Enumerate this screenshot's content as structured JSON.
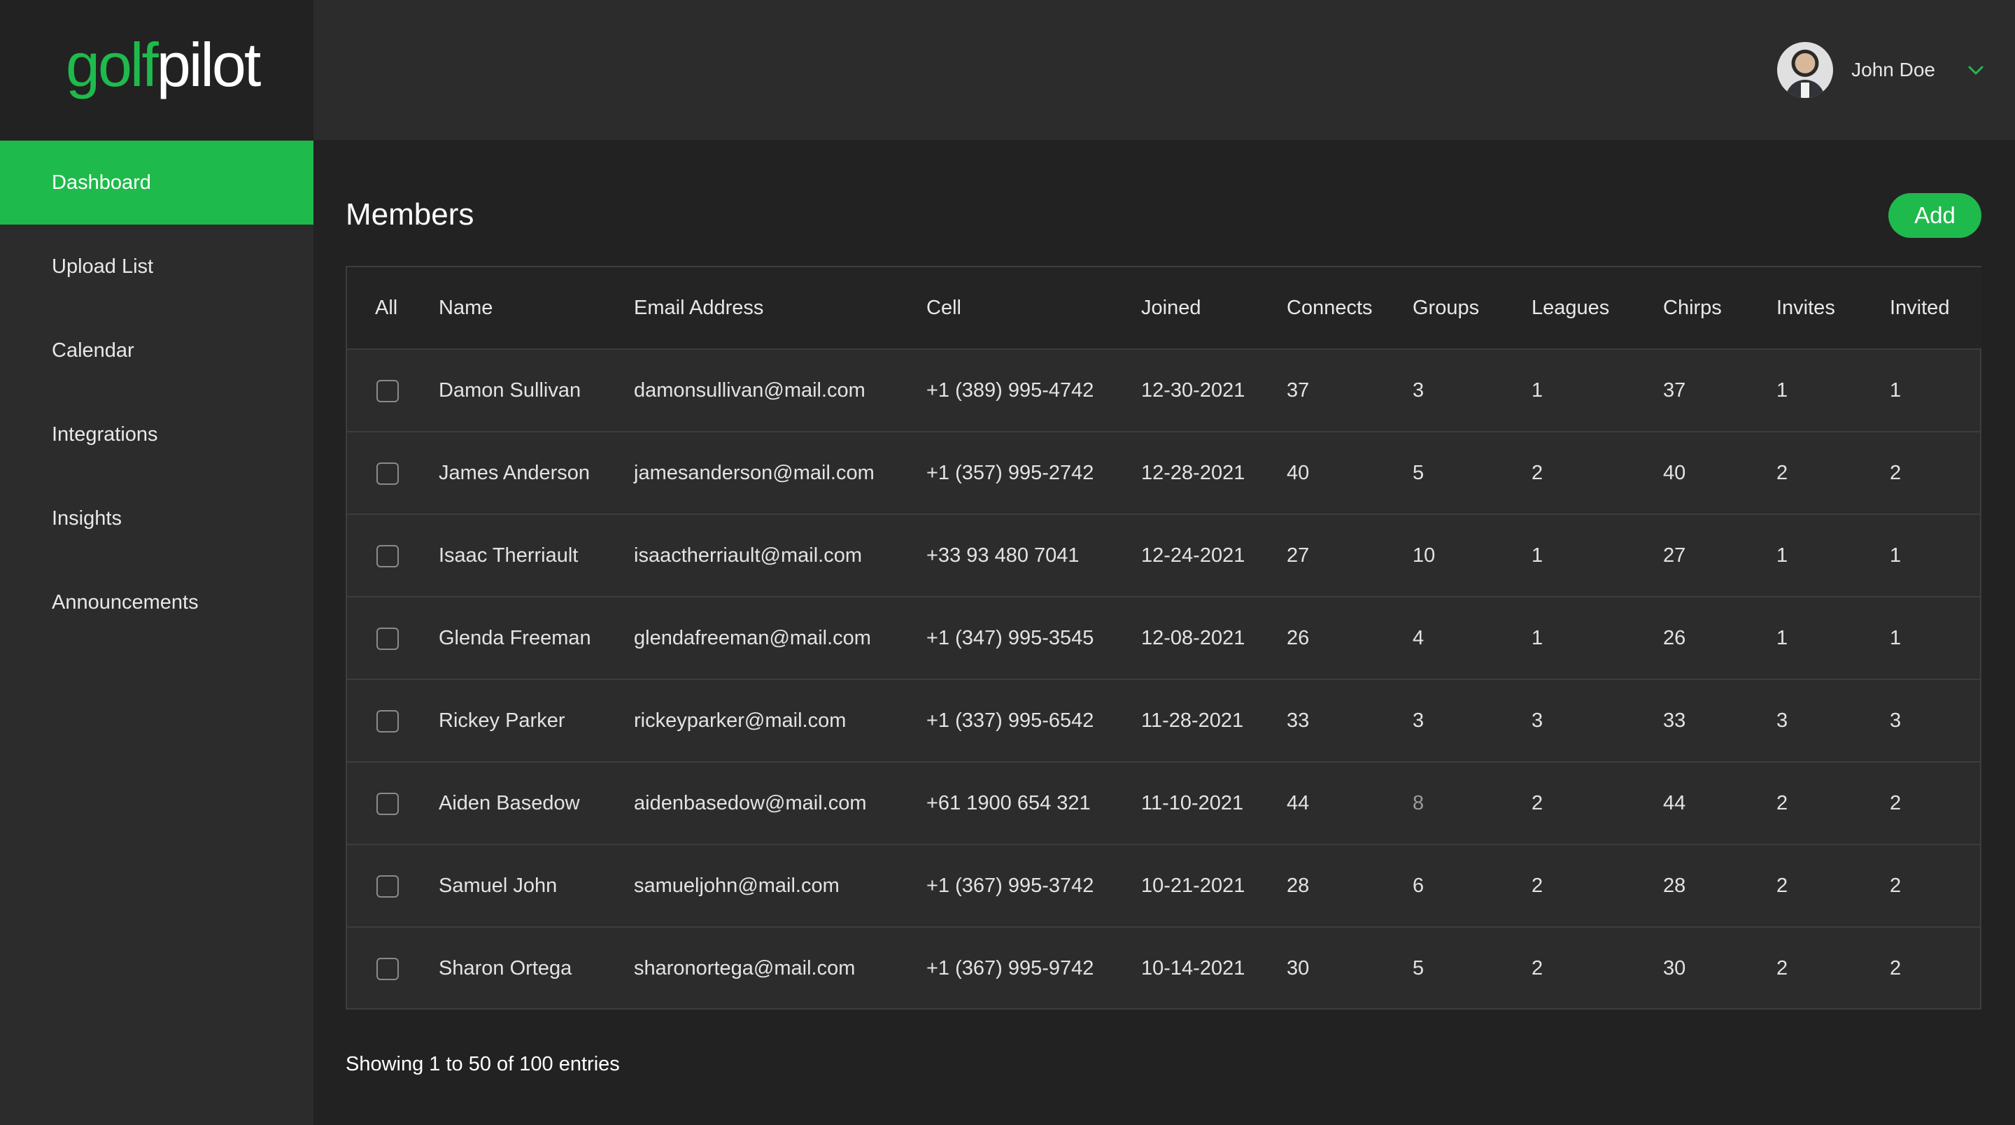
{
  "brand": {
    "logo_part1": "golf",
    "logo_part2": "pilot"
  },
  "sidebar": {
    "items": [
      {
        "label": "Dashboard",
        "active": true
      },
      {
        "label": "Upload List"
      },
      {
        "label": "Calendar"
      },
      {
        "label": "Integrations"
      },
      {
        "label": "Insights"
      },
      {
        "label": "Announcements"
      }
    ]
  },
  "header": {
    "user_name": "John Doe",
    "dropdown_icon": "chevron-down-icon",
    "avatar": "user-avatar"
  },
  "main": {
    "title": "Members",
    "add_label": "Add",
    "columns": [
      "All",
      "Name",
      "Email Address",
      "Cell",
      "Joined",
      "Connects",
      "Groups",
      "Leagues",
      "Chirps",
      "Invites",
      "Invited"
    ],
    "rows": [
      {
        "name": "Damon Sullivan",
        "email": "damonsullivan@mail.com",
        "cell": "+1 (389) 995-4742",
        "joined": "12-30-2021",
        "connects": "37",
        "groups": "3",
        "leagues": "1",
        "chirps": "37",
        "invites": "1",
        "invited": "1"
      },
      {
        "name": "James Anderson",
        "email": "jamesanderson@mail.com",
        "cell": "+1 (357) 995-2742",
        "joined": "12-28-2021",
        "connects": "40",
        "groups": "5",
        "leagues": "2",
        "chirps": "40",
        "invites": "2",
        "invited": "2"
      },
      {
        "name": "Isaac Therriault",
        "email": "isaactherriault@mail.com",
        "cell": "+33 93 480 7041",
        "joined": "12-24-2021",
        "connects": "27",
        "groups": "10",
        "leagues": "1",
        "chirps": "27",
        "invites": "1",
        "invited": "1"
      },
      {
        "name": "Glenda Freeman",
        "email": "glendafreeman@mail.com",
        "cell": "+1 (347) 995-3545",
        "joined": "12-08-2021",
        "connects": "26",
        "groups": "4",
        "leagues": "1",
        "chirps": "26",
        "invites": "1",
        "invited": "1"
      },
      {
        "name": "Rickey Parker",
        "email": "rickeyparker@mail.com",
        "cell": "+1 (337) 995-6542",
        "joined": "11-28-2021",
        "connects": "33",
        "groups": "3",
        "leagues": "3",
        "chirps": "33",
        "invites": "3",
        "invited": "3"
      },
      {
        "name": "Aiden Basedow",
        "email": "aidenbasedow@mail.com",
        "cell": "+61 1900 654 321",
        "joined": "11-10-2021",
        "connects": "44",
        "groups": "8",
        "leagues": "2",
        "chirps": "44",
        "invites": "2",
        "invited": "2"
      },
      {
        "name": "Samuel John",
        "email": "samueljohn@mail.com",
        "cell": "+1 (367) 995-3742",
        "joined": "10-21-2021",
        "connects": "28",
        "groups": "6",
        "leagues": "2",
        "chirps": "28",
        "invites": "2",
        "invited": "2"
      },
      {
        "name": "Sharon Ortega",
        "email": "sharonortega@mail.com",
        "cell": "+1 (367) 995-9742",
        "joined": "10-14-2021",
        "connects": "30",
        "groups": "5",
        "leagues": "2",
        "chirps": "30",
        "invites": "2",
        "invited": "2"
      }
    ],
    "footer": "Showing 1 to 50 of 100 entries"
  },
  "colors": {
    "accent": "#1fba4c",
    "background": "#222222",
    "panel": "#2c2c2d"
  }
}
